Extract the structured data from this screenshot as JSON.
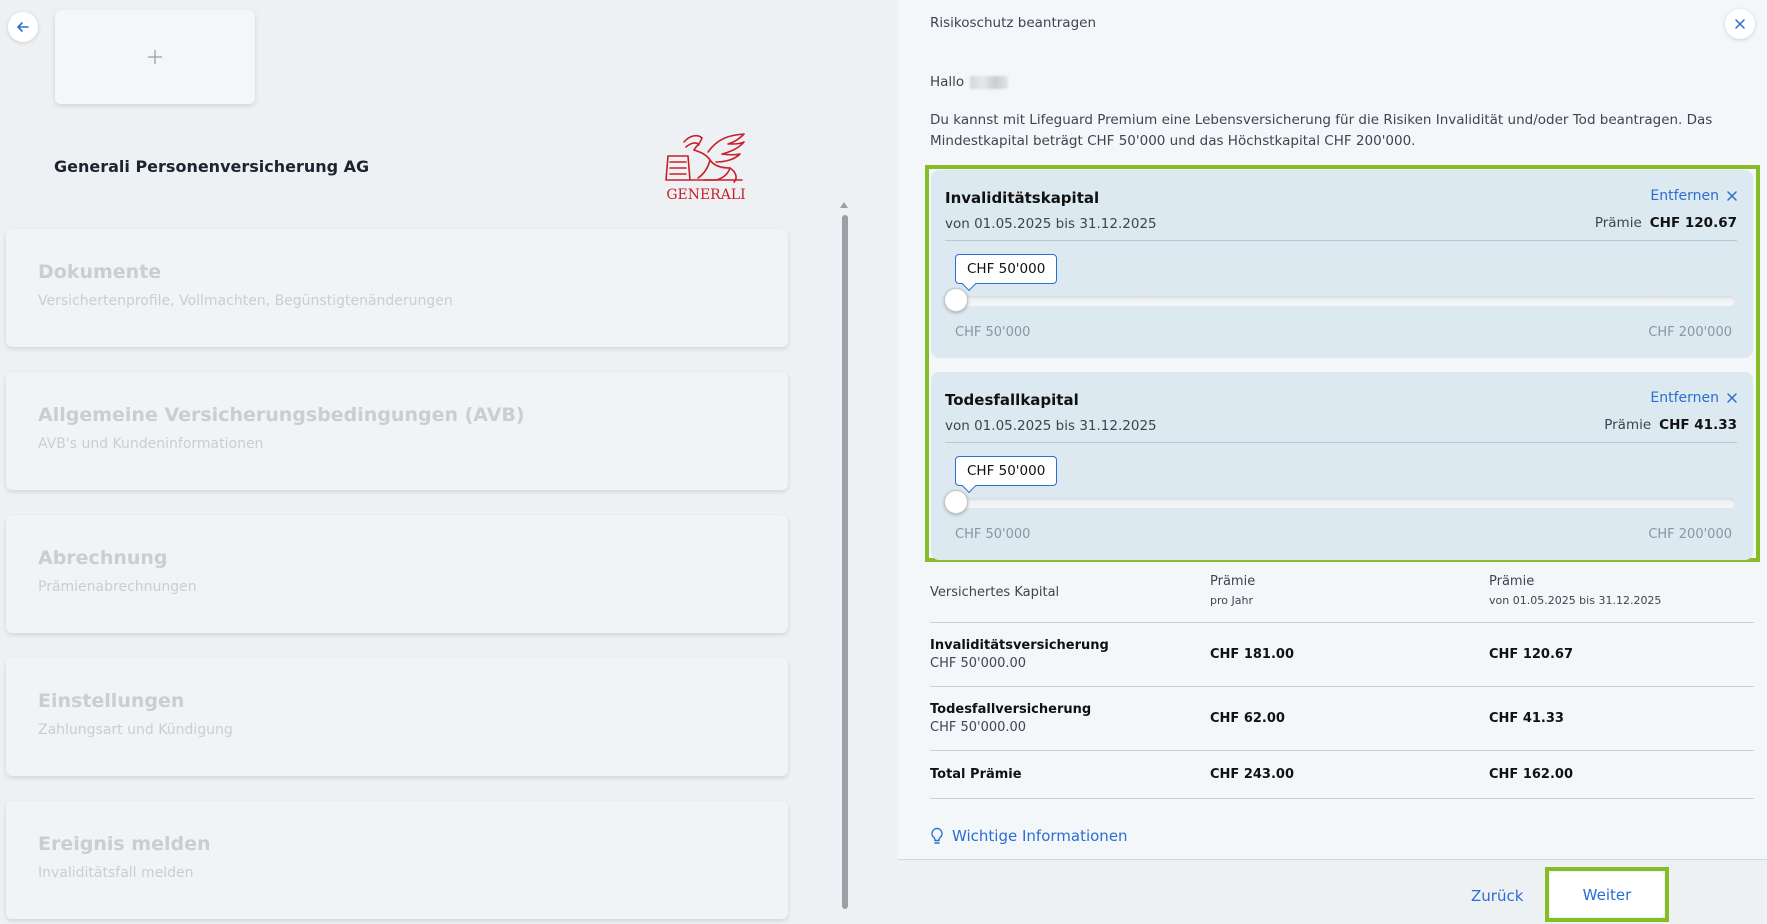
{
  "left": {
    "company": "Generali Personenversicherung AG",
    "logo_text": "GENERALI",
    "menu": [
      {
        "title": "Dokumente",
        "subtitle": "Versichertenprofile, Vollmachten, Begünstigtenänderungen"
      },
      {
        "title": "Allgemeine Versicherungsbedingungen (AVB)",
        "subtitle": "AVB's und Kundeninformationen"
      },
      {
        "title": "Abrechnung",
        "subtitle": "Prämienabrechnungen"
      },
      {
        "title": "Einstellungen",
        "subtitle": "Zahlungsart und Kündigung"
      },
      {
        "title": "Ereignis melden",
        "subtitle": "Invaliditätsfall melden"
      }
    ]
  },
  "dialog": {
    "title": "Risikoschutz beantragen",
    "greeting": "Hallo",
    "intro": "Du kannst mit Lifeguard Premium eine Lebensversicherung für die Risiken Invalidität und/oder Tod beantragen. Das Mindestkapital beträgt CHF 50'000 und das Höchstkapital CHF 200'000.",
    "covers": [
      {
        "title": "Invaliditätskapital",
        "remove_label": "Entfernen",
        "period": "von 01.05.2025 bis 31.12.2025",
        "premium_label": "Prämie",
        "premium_value": "CHF 120.67",
        "slider_value": "CHF 50'000",
        "slider_level": 0,
        "min_label": "CHF 50'000",
        "max_label": "CHF 200'000"
      },
      {
        "title": "Todesfallkapital",
        "remove_label": "Entfernen",
        "period": "von 01.05.2025 bis 31.12.2025",
        "premium_label": "Prämie",
        "premium_value": "CHF 41.33",
        "slider_value": "CHF 50'000",
        "slider_level": 0,
        "min_label": "CHF 50'000",
        "max_label": "CHF 200'000"
      }
    ],
    "summary": {
      "header": {
        "col1": "Versichertes Kapital",
        "col2": "Prämie",
        "col2_sub": "pro Jahr",
        "col3": "Prämie",
        "col3_sub": "von 01.05.2025 bis 31.12.2025"
      },
      "rows": [
        {
          "name": "Invaliditätsversicherung",
          "capital": "CHF 50'000.00",
          "per_year": "CHF 181.00",
          "period": "CHF 120.67"
        },
        {
          "name": "Todesfallversicherung",
          "capital": "CHF 50'000.00",
          "per_year": "CHF 62.00",
          "period": "CHF 41.33"
        }
      ],
      "total": {
        "label": "Total Prämie",
        "per_year": "CHF 243.00",
        "period": "CHF 162.00"
      }
    },
    "info_link": "Wichtige Informationen",
    "back_label": "Zurück",
    "next_label": "Weiter"
  },
  "colors": {
    "accent": "#2a6ed1",
    "highlight": "#86bc25",
    "card": "#dde9f0",
    "brand_red": "#c8202a"
  }
}
